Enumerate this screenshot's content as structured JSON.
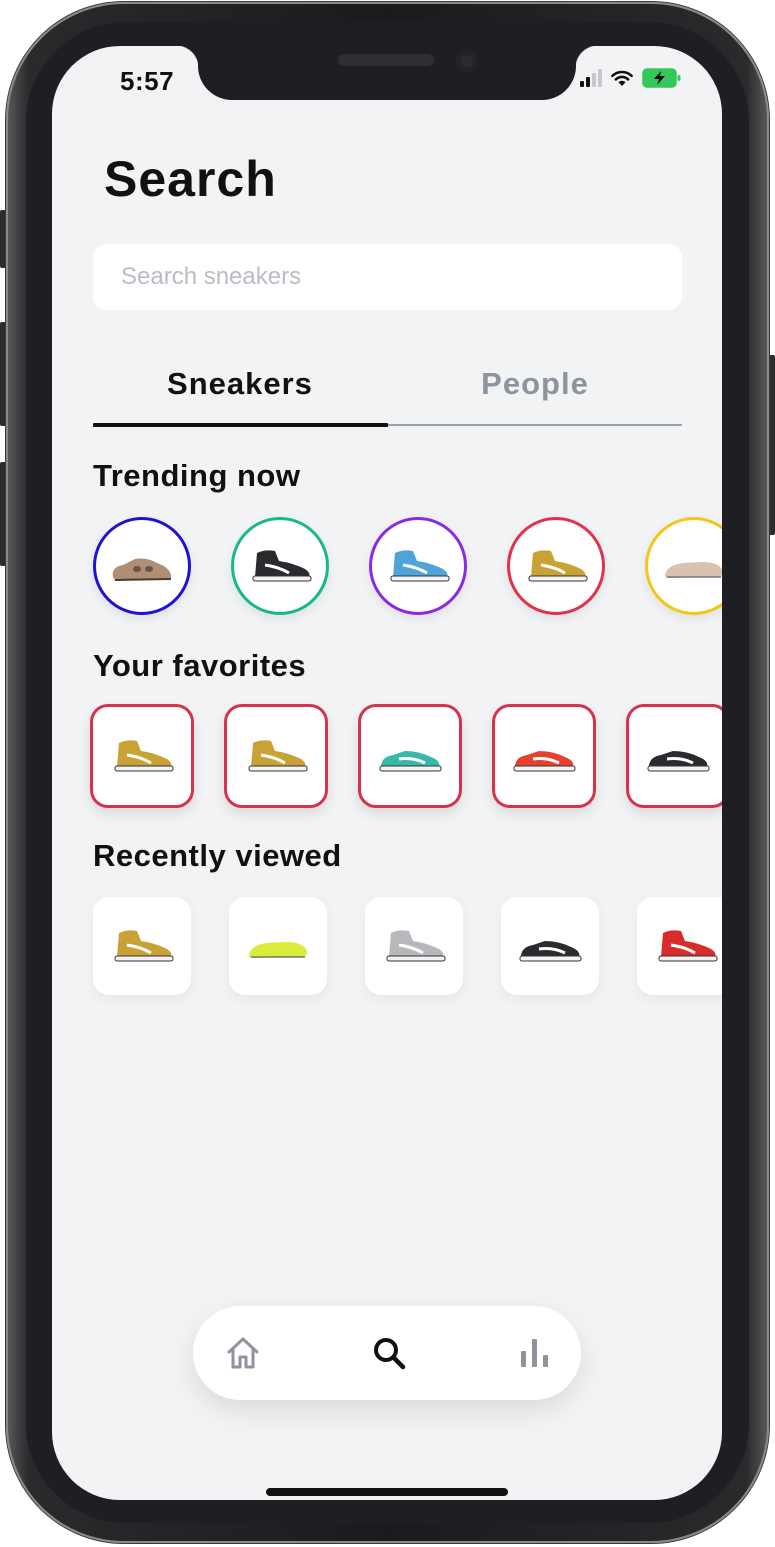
{
  "status_bar": {
    "time": "5:57",
    "battery_color": "#34c759"
  },
  "page": {
    "title": "Search"
  },
  "search": {
    "placeholder": "Search sneakers",
    "value": ""
  },
  "tabs": [
    {
      "label": "Sneakers",
      "active": true
    },
    {
      "label": "People",
      "active": false
    }
  ],
  "sections": {
    "trending": {
      "title": "Trending now",
      "items": [
        {
          "icon": "sneaker-icon",
          "ring_color": "#1f12d6",
          "shoe": "slip-on",
          "color": "#b08d76"
        },
        {
          "icon": "sneaker-icon",
          "ring_color": "#19b88a",
          "shoe": "high",
          "color": "#2b2b2f"
        },
        {
          "icon": "sneaker-icon",
          "ring_color": "#8a2be2",
          "shoe": "high",
          "color": "#4fa3d8"
        },
        {
          "icon": "sneaker-icon",
          "ring_color": "#e0314d",
          "shoe": "high",
          "color": "#c9a236"
        },
        {
          "icon": "slide-icon",
          "ring_color": "#f5c518",
          "shoe": "slide",
          "color": "#d9c3b0"
        }
      ]
    },
    "favorites": {
      "title": "Your favorites",
      "border_color": "#d6324c",
      "items": [
        {
          "icon": "sneaker-icon",
          "shoe": "high",
          "color": "#c9a236"
        },
        {
          "icon": "sneaker-icon",
          "shoe": "high",
          "color": "#c9a236"
        },
        {
          "icon": "sneaker-icon",
          "shoe": "low",
          "color": "#37b8a8"
        },
        {
          "icon": "sneaker-icon",
          "shoe": "low",
          "color": "#e8402f"
        },
        {
          "icon": "sneaker-icon",
          "shoe": "low",
          "color": "#2b2b2f"
        }
      ]
    },
    "recent": {
      "title": "Recently viewed",
      "items": [
        {
          "icon": "sneaker-icon",
          "shoe": "high",
          "color": "#c9a236"
        },
        {
          "icon": "slide-icon",
          "shoe": "slide",
          "color": "#d9ec3c"
        },
        {
          "icon": "sneaker-icon",
          "shoe": "high",
          "color": "#b8b8bc"
        },
        {
          "icon": "sneaker-icon",
          "shoe": "low",
          "color": "#2b2b2f"
        },
        {
          "icon": "sneaker-icon",
          "shoe": "high",
          "color": "#d92b2b"
        }
      ]
    }
  },
  "bottom_nav": [
    {
      "icon": "home-icon",
      "active": false
    },
    {
      "icon": "search-icon",
      "active": true
    },
    {
      "icon": "stats-icon",
      "active": false
    }
  ]
}
